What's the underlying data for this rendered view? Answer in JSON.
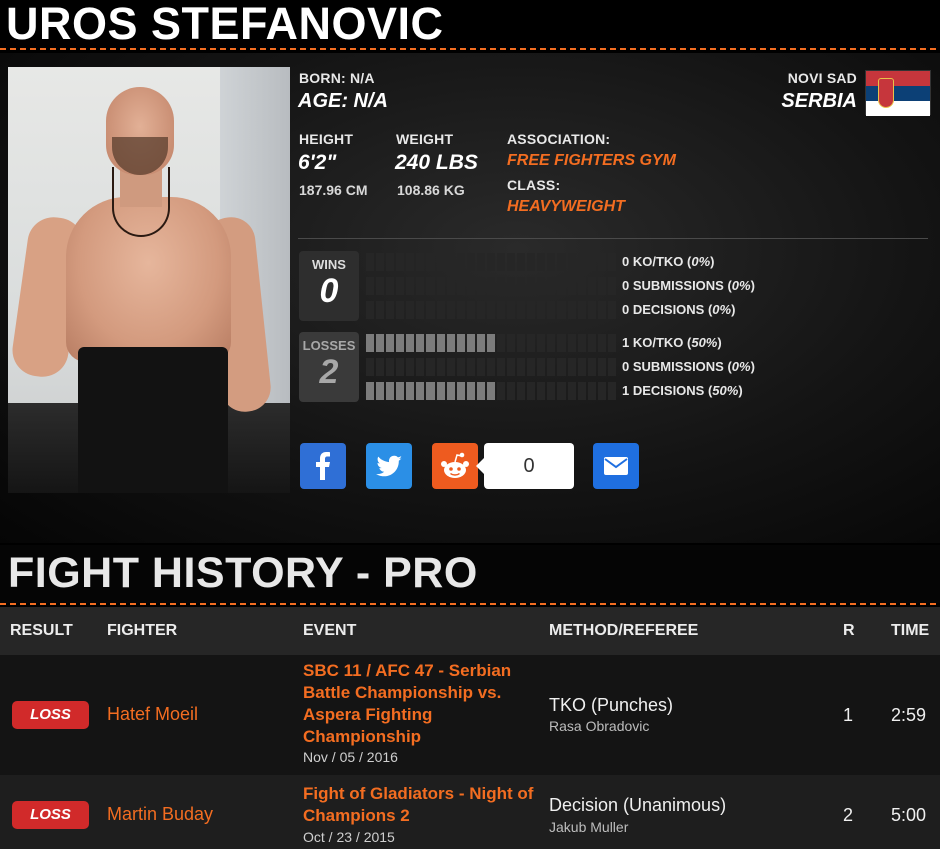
{
  "fighter": {
    "name": "UROS STEFANOVIC",
    "born_label": "BORN: N/A",
    "age_label": "AGE: N/A",
    "height_label": "HEIGHT",
    "height_ft": "6'2\"",
    "height_cm": "187.96 CM",
    "weight_label": "WEIGHT",
    "weight_lbs": "240 LBS",
    "weight_kg": "108.86 KG",
    "association_label": "ASSOCIATION:",
    "association": "FREE FIGHTERS GYM",
    "class_label": "CLASS:",
    "class": "HEAVYWEIGHT",
    "city": "NOVI SAD",
    "country": "SERBIA"
  },
  "record": {
    "wins": {
      "label": "WINS",
      "value": "0",
      "ko": {
        "text": "0 KO/TKO (",
        "pct": "0%",
        "end": ")",
        "fraction": 0
      },
      "sub": {
        "text": "0 SUBMISSIONS (",
        "pct": "0%",
        "end": ")",
        "fraction": 0
      },
      "dec": {
        "text": "0 DECISIONS (",
        "pct": "0%",
        "end": ")",
        "fraction": 0
      }
    },
    "losses": {
      "label": "LOSSES",
      "value": "2",
      "ko": {
        "text": "1 KO/TKO (",
        "pct": "50%",
        "end": ")",
        "fraction": 0.5
      },
      "sub": {
        "text": "0 SUBMISSIONS (",
        "pct": "0%",
        "end": ")",
        "fraction": 0
      },
      "dec": {
        "text": "1 DECISIONS (",
        "pct": "50%",
        "end": ")",
        "fraction": 0.5
      }
    }
  },
  "share": {
    "count": "0",
    "colors": {
      "facebook": "#2f6fd6",
      "twitter": "#2b8fe6",
      "reddit": "#ee5b1f",
      "email": "#1f6fe0"
    }
  },
  "history": {
    "title": "FIGHT HISTORY - PRO",
    "columns": {
      "result": "RESULT",
      "fighter": "FIGHTER",
      "event": "EVENT",
      "method": "METHOD/REFEREE",
      "round": "R",
      "time": "TIME"
    },
    "rows": [
      {
        "result": "LOSS",
        "opponent": "Hatef Moeil",
        "event": "SBC 11 / AFC 47 - Serbian Battle Championship vs. Aspera Fighting Championship",
        "date": "Nov / 05 / 2016",
        "method": "TKO (Punches)",
        "referee": "Rasa Obradovic",
        "round": "1",
        "time": "2:59"
      },
      {
        "result": "LOSS",
        "opponent": "Martin Buday",
        "event": "Fight of Gladiators - Night of Champions 2",
        "date": "Oct / 23 / 2015",
        "method": "Decision (Unanimous)",
        "referee": "Jakub Muller",
        "round": "2",
        "time": "5:00"
      }
    ]
  },
  "colors": {
    "accent": "#f36d21",
    "loss_badge": "#d12a2a",
    "flag_red": "#c6363c",
    "flag_blue": "#0c4076"
  }
}
